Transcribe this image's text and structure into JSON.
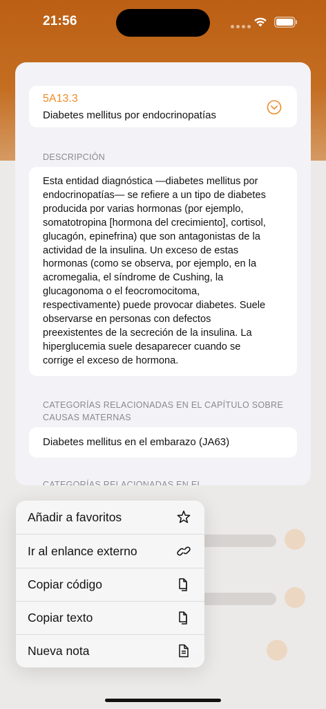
{
  "status": {
    "time": "21:56"
  },
  "entry": {
    "code": "5A13.3",
    "title": "Diabetes mellitus por endocrinopatías"
  },
  "description": {
    "header": "DESCRIPCIÓN",
    "lines": [
      "Esta entidad diagnóstica —diabetes mellitus por",
      "endocrinopatías— se refiere a un tipo de diabetes",
      "producida por varias hormonas (por ejemplo,",
      "somatotropina [hormona del crecimiento], cortisol,",
      "glucagón, epinefrina) que son antagonistas de la",
      "actividad de la insulina. Un exceso de estas",
      "hormonas (como se observa, por ejemplo, en la",
      "acromegalia, el síndrome de Cushing, la",
      "glucagonoma o el feocromocitoma,",
      "respectivamente) puede provocar diabetes. Suele",
      "observarse en personas con defectos",
      "preexistentes de la secreción de la insulina. La",
      "hiperglucemia suele desaparecer cuando se",
      "corrige el exceso de hormona."
    ]
  },
  "related_maternal": {
    "header_line1": "CATEGORÍAS RELACIONADAS EN EL CAPÍTULO SOBRE",
    "header_line2": "CAUSAS MATERNAS",
    "item": "Diabetes mellitus en el embarazo (JA63)"
  },
  "next_section_header": "CATEGORÍAS RELACIONADAS EN EL",
  "menu": {
    "items": [
      {
        "label": "Añadir a favoritos",
        "icon": "star-icon"
      },
      {
        "label": "Ir al enlance externo",
        "icon": "link-icon"
      },
      {
        "label": "Copiar código",
        "icon": "copy-icon"
      },
      {
        "label": "Copiar texto",
        "icon": "copy-icon"
      },
      {
        "label": "Nueva nota",
        "icon": "note-icon"
      }
    ]
  },
  "colors": {
    "accent": "#ed8c2b",
    "header_bg": "#c0651a"
  }
}
